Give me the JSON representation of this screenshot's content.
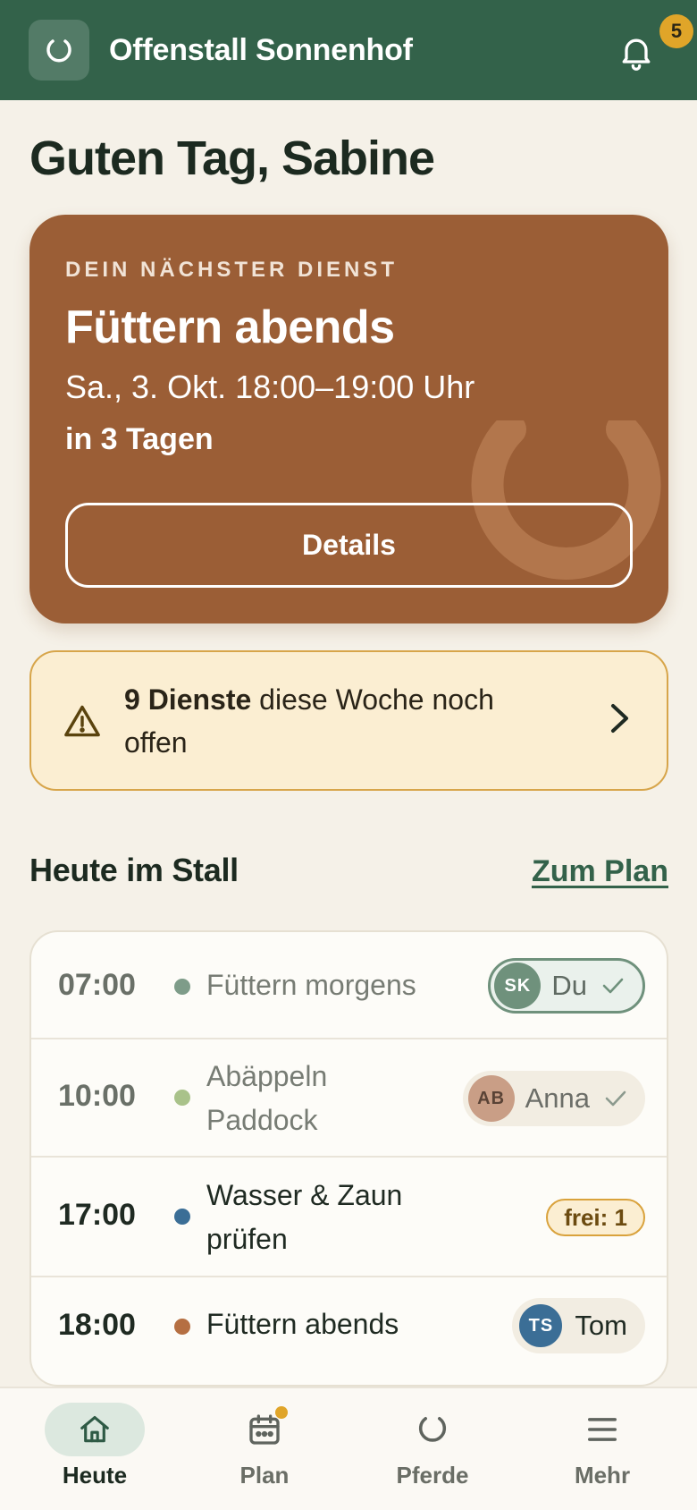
{
  "header": {
    "app_title": "Offenstall Sonnenhof",
    "notification_count": "5",
    "logo_icon": "horseshoe-icon",
    "bell_icon": "bell-icon",
    "bg_color": "#33624a"
  },
  "greeting": "Guten Tag, Sabine",
  "next_duty": {
    "eyebrow": "DEIN NÄCHSTER DIENST",
    "title": "Füttern abends",
    "when": "Sa., 3. Okt. 18:00–19:00 Uhr",
    "relative": "in 3 Tagen",
    "button_label": "Details",
    "bg_color": "#9b5e36"
  },
  "alert": {
    "count_text": "9 Dienste",
    "rest_text": " diese Woche noch offen",
    "icon": "warning-icon"
  },
  "today": {
    "title": "Heute im Stall",
    "link_label": "Zum Plan",
    "rows": [
      {
        "time": "07:00",
        "task": "Füttern morgens",
        "dot_color": "#7e9c89",
        "assignee_initials": "SK",
        "assignee_name": "Du",
        "done": true
      },
      {
        "time": "10:00",
        "task": "Abäppeln Paddock",
        "dot_color": "#a9c28a",
        "assignee_initials": "AB",
        "assignee_name": "Anna",
        "done": true
      },
      {
        "time": "17:00",
        "task": "Wasser & Zaun prüfen",
        "dot_color": "#3b6e96",
        "free_label": "frei: 1",
        "done": false
      },
      {
        "time": "18:00",
        "task": "Füttern abends",
        "dot_color": "#b56f42",
        "assignee_initials": "TS",
        "assignee_name": "Tom",
        "done": false
      }
    ]
  },
  "tabbar": {
    "tabs": [
      {
        "label": "Heute",
        "icon": "home-icon",
        "active": true
      },
      {
        "label": "Plan",
        "icon": "calendar-icon",
        "active": false
      },
      {
        "label": "Pferde",
        "icon": "horseshoe-icon",
        "active": false
      },
      {
        "label": "Mehr",
        "icon": "menu-icon",
        "active": false
      }
    ]
  }
}
